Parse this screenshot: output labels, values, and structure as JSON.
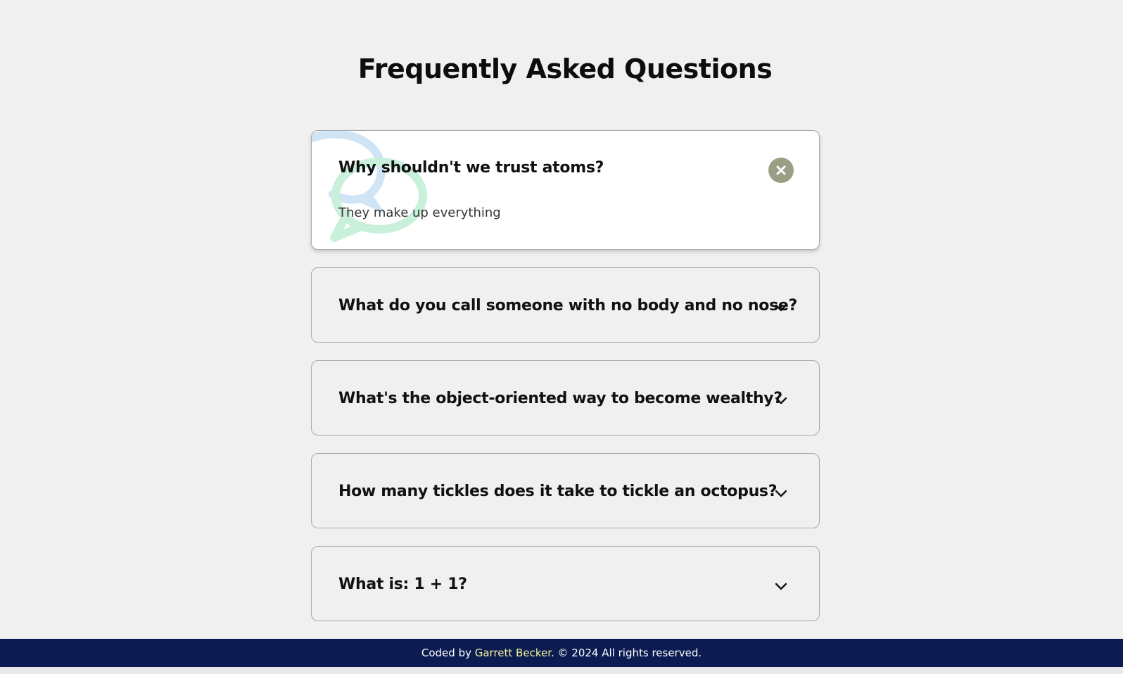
{
  "page": {
    "title": "Frequently Asked Questions"
  },
  "faq": {
    "items": [
      {
        "question": "Why shouldn't we trust atoms?",
        "answer": "They make up everything",
        "expanded": true
      },
      {
        "question": "What do you call someone with no body and no nose?",
        "expanded": false
      },
      {
        "question": "What's the object-oriented way to become wealthy?",
        "expanded": false
      },
      {
        "question": "How many tickles does it take to tickle an octopus?",
        "expanded": false
      },
      {
        "question": "What is: 1 + 1?",
        "expanded": false
      }
    ]
  },
  "footer": {
    "prefix": "Coded by ",
    "author": "Garrett Becker",
    "suffix": ". © 2024 All rights reserved."
  },
  "colors": {
    "background": "#f0f0f0",
    "close_button": "#9a9e84",
    "footer_background": "#0c1c52",
    "author_link": "#f2f29a",
    "bubble_blue": "#cfe4f5",
    "bubble_green": "#c8f0da"
  },
  "icons": {
    "expanded": "close-icon",
    "collapsed": "chevron-down-icon",
    "decoration": "speech-bubbles-icon"
  }
}
